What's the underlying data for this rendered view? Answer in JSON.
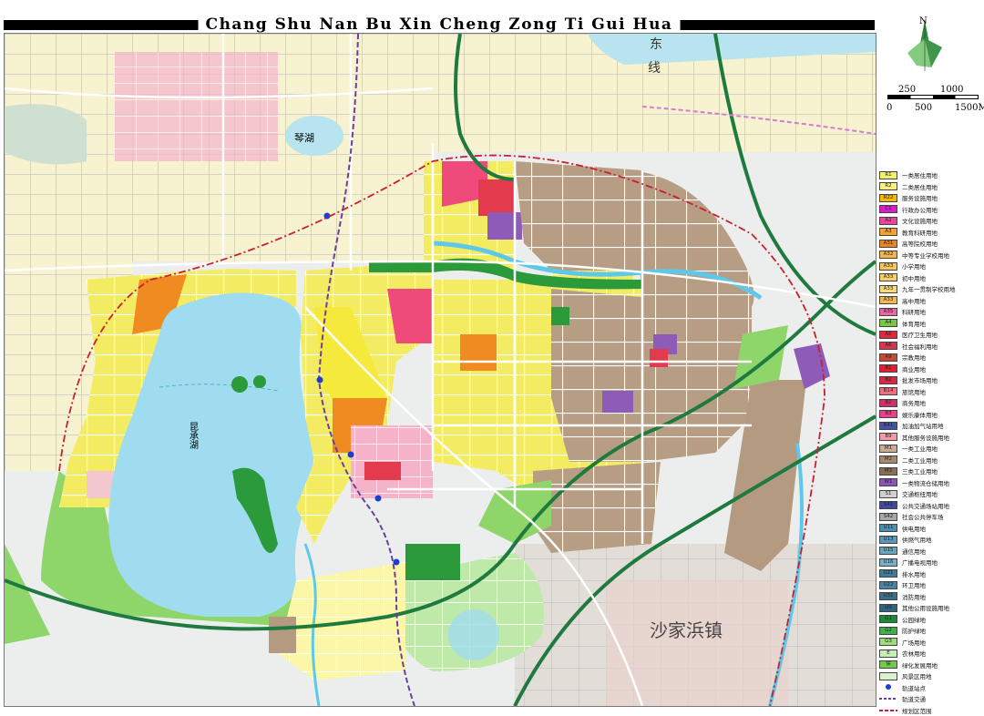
{
  "title": "Chang Shu Nan Bu Xin Cheng Zong Ti Gui Hua",
  "map_labels": {
    "lake_east": "昆承湖",
    "lake_north": "琴湖",
    "town": "沙家浜镇",
    "dongxian": "东线",
    "dong": "东",
    "xian": "线"
  },
  "compass": {
    "north": "N"
  },
  "scale": {
    "top_250": "250",
    "top_1000": "1000",
    "bottom_0": "0",
    "bottom_500": "500",
    "bottom_1500": "1500M"
  },
  "colors": {
    "water": "#9fdcf0",
    "residential_r1": "#f2ef6a",
    "residential_r2": "#fbf080",
    "industrial": "#b59a82",
    "green": "#2b9a3b",
    "greenbelt": "#8fd66a",
    "commercial": "#e33a4d",
    "pink": "#ee4a7a",
    "orange": "#ef8b21",
    "purple": "#8e5bb8",
    "road": "#ffffff",
    "highway": "#1f7a3f"
  },
  "legend": [
    {
      "code": "R1",
      "label": "一类居住用地",
      "color": "#f2ef6a"
    },
    {
      "code": "R2",
      "label": "二类居住用地",
      "color": "#fbf080"
    },
    {
      "code": "R22",
      "label": "服务设施用地",
      "color": "#f5b800"
    },
    {
      "code": "C1",
      "label": "行政办公用地",
      "color": "#d81ec8"
    },
    {
      "code": "A2",
      "label": "文化设施用地",
      "color": "#e8459b"
    },
    {
      "code": "A3",
      "label": "教育科研用地",
      "color": "#f1a32b"
    },
    {
      "code": "A31",
      "label": "高等院校用地",
      "color": "#ee8420"
    },
    {
      "code": "A32",
      "label": "中等专业学校用地",
      "color": "#f7b44b"
    },
    {
      "code": "A33",
      "label": "小学用地",
      "color": "#f8c55e"
    },
    {
      "code": "A33",
      "label": "初中用地",
      "color": "#f7d06a"
    },
    {
      "code": "A33",
      "label": "九年一贯制学校用地",
      "color": "#f9d978"
    },
    {
      "code": "A33",
      "label": "高中用地",
      "color": "#f3b950"
    },
    {
      "code": "A35",
      "label": "科研用地",
      "color": "#ea68a1"
    },
    {
      "code": "A4",
      "label": "体育用地",
      "color": "#79c843"
    },
    {
      "code": "A5",
      "label": "医疗卫生用地",
      "color": "#e6263c"
    },
    {
      "code": "A6",
      "label": "社会福利用地",
      "color": "#d6344f"
    },
    {
      "code": "A9",
      "label": "宗教用地",
      "color": "#c44a3a"
    },
    {
      "code": "B1",
      "label": "商业用地",
      "color": "#e21f35"
    },
    {
      "code": "B2",
      "label": "批发市场用地",
      "color": "#dc2742"
    },
    {
      "code": "B14",
      "label": "旅馆用地",
      "color": "#f26f7f"
    },
    {
      "code": "B2",
      "label": "商务用地",
      "color": "#d22f6a"
    },
    {
      "code": "B3",
      "label": "娱乐康体用地",
      "color": "#ee3f8d"
    },
    {
      "code": "B41",
      "label": "加油加气站用地",
      "color": "#4652a6"
    },
    {
      "code": "B9",
      "label": "其他服务设施用地",
      "color": "#f59aa6"
    },
    {
      "code": "M1",
      "label": "一类工业用地",
      "color": "#c9ac93"
    },
    {
      "code": "M2",
      "label": "二类工业用地",
      "color": "#a88a71"
    },
    {
      "code": "M3",
      "label": "三类工业用地",
      "color": "#8c6d55"
    },
    {
      "code": "W1",
      "label": "一类物流仓储用地",
      "color": "#8a56b8"
    },
    {
      "code": "S1",
      "label": "交通枢纽用地",
      "color": "#d0d0d0"
    },
    {
      "code": "S41",
      "label": "公共交通场站用地",
      "color": "#3d4aa0"
    },
    {
      "code": "S42",
      "label": "社会公共停车场",
      "color": "#a8a8a8"
    },
    {
      "code": "U11",
      "label": "供电用地",
      "color": "#4d8fb0"
    },
    {
      "code": "U13",
      "label": "供燃气用地",
      "color": "#5a9ab8"
    },
    {
      "code": "U15",
      "label": "通信用地",
      "color": "#68a6bf"
    },
    {
      "code": "U16",
      "label": "广播电视用地",
      "color": "#77b1c6"
    },
    {
      "code": "U21",
      "label": "排水用地",
      "color": "#3f7c9b"
    },
    {
      "code": "U22",
      "label": "环卫用地",
      "color": "#4a86a3"
    },
    {
      "code": "U31",
      "label": "消防用地",
      "color": "#3a6f8c"
    },
    {
      "code": "U9",
      "label": "其他公用设施用地",
      "color": "#2f6380"
    },
    {
      "code": "G1",
      "label": "公园绿地",
      "color": "#1f8a35"
    },
    {
      "code": "G2",
      "label": "防护绿地",
      "color": "#3fb04a"
    },
    {
      "code": "G3",
      "label": "广场用地",
      "color": "#9fdc7b"
    },
    {
      "code": "E",
      "label": "农林用地",
      "color": "#c7edb8"
    },
    {
      "code": "保",
      "label": "绿化发展用地",
      "color": "#74c84e"
    },
    {
      "code": "",
      "label": "风景区用地",
      "color": "#d8f3c8"
    },
    {
      "code": "",
      "label": "轨道站点",
      "color": "#ffffff",
      "symbol": "dot"
    },
    {
      "code": "",
      "label": "轨道交通",
      "color": "#ffffff",
      "symbol": "dash-purple"
    },
    {
      "code": "",
      "label": "规划区范围",
      "color": "#ffffff",
      "symbol": "dash-red"
    }
  ]
}
